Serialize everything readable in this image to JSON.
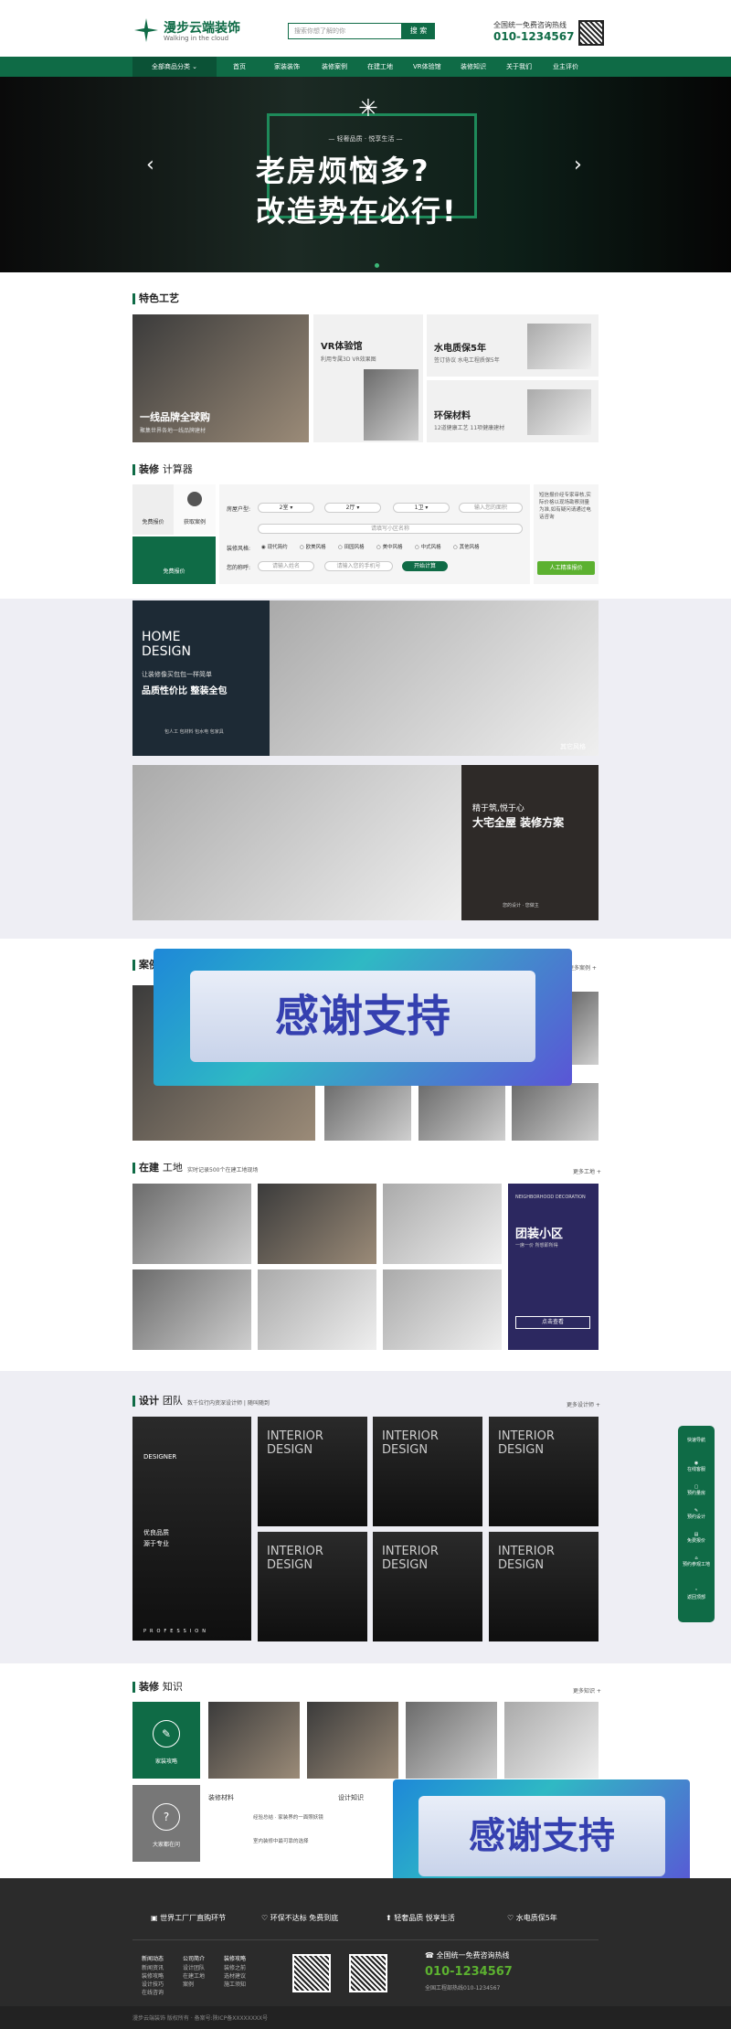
{
  "header": {
    "logo_name": "漫步云端装饰",
    "logo_sub": "Walking in the cloud",
    "search_placeholder": "搜索你想了解的你",
    "search_btn": "搜 索",
    "phone_title": "全国统一免费咨询热线",
    "phone": "010-1234567"
  },
  "nav": {
    "all": "全部商品分类",
    "items": [
      "首页",
      "家装装饰",
      "装修案例",
      "在建工地",
      "VR体验馆",
      "装修知识",
      "关于我们",
      "业主评价"
    ]
  },
  "banner": {
    "sub": "— 轻奢品质 · 悦享生活 —",
    "line1": "老房烦恼多?",
    "line2": "改造势在必行!"
  },
  "features": {
    "title": "特色工艺",
    "c1": "一线品牌全球购",
    "c1s": "聚集世界各地一线品牌建材",
    "c2": "VR体验馆",
    "c2s": "利用专属3D VR效果图",
    "c3": "水电质保5年",
    "c3s": "签订协议 水电工程质保5年",
    "c4": "环保材料",
    "c4s": "12道健康工艺 11项健康建材"
  },
  "calc": {
    "title": "装修",
    "title2": "计算器",
    "tab1": "免费报价",
    "tab2": "获取案例",
    "tab3": "免费报价",
    "house": "房屋户型:",
    "opt1": "2室",
    "opt2": "2厅",
    "opt3": "1卫",
    "area": "输入您的面积",
    "community": "请填写小区名称",
    "style_label": "装修风格:",
    "styles": [
      "现代简约",
      "欧美风格",
      "田园风格",
      "美中风格",
      "中式风格",
      "其他风格"
    ],
    "name_label": "您的称呼:",
    "name_ph": "请输入姓名",
    "phone_ph": "请输入您的手机号",
    "calc_btn": "开始计算",
    "right_text": "短信报价经专家审核,实际价格以现场勘察测量为准,如有疑问请通过电话咨询",
    "right_btn": "人工精准报价"
  },
  "promo": {
    "p1a": "HOME",
    "p1b": "DESIGN",
    "p1c": "让装修像买包包一样简单",
    "p1d": "品质性价比 整装全包",
    "p1e": "包人工 包材料 包水电 包家具",
    "p2a": "精于筑,悦于心",
    "p2b": "大宅全屋 装修方案",
    "p2c": "您的设计 · 您做主",
    "p3": "其它风格"
  },
  "cases": {
    "title": "案例",
    "more": "更多案例 +"
  },
  "overlay_text": "感谢支持",
  "sites": {
    "title": "在建",
    "title2": "工地",
    "sub": "实时记录500个在建工地现场",
    "more": "更多工地 +",
    "promo_en": "NEIGHBORHOOD DECORATION",
    "promo_title": "团装小区",
    "promo_sub": "一席一价 所想即所得",
    "promo_btn": "点击查看"
  },
  "team": {
    "title": "设计",
    "title2": "团队",
    "sub": "数千位行内资深设计师 | 随叫随到",
    "more": "更多设计师 +",
    "lead_en": "DESIGNER",
    "lead_cn": "优良品质",
    "lead_cn2": "源于专业",
    "bottom": "PROFESSION",
    "card": "INTERIOR DESIGN"
  },
  "knowledge": {
    "title": "装修",
    "title2": "知识",
    "more": "更多知识 +",
    "k1": "家装攻略",
    "k2": "大家都在问",
    "sub1": "装修材料",
    "sub2": "设计知识",
    "txt1": "经验总结 · 家装界的一面照妖镜",
    "txt2": "室内装修中最可靠的选择"
  },
  "footer_bar": [
    {
      "t": "世界工厂厂直购环节"
    },
    {
      "t": "环保不达标 免费到底"
    },
    {
      "t": "轻奢品质 悦享生活"
    },
    {
      "t": "水电质保5年"
    }
  ],
  "footer": {
    "cols": [
      {
        "h": "新闻动态",
        "items": [
          "新闻资讯",
          "装修攻略",
          "设计技巧",
          "在线咨询"
        ]
      },
      {
        "h": "公司简介",
        "items": [
          "设计团队",
          "在建工地",
          "案例"
        ]
      },
      {
        "h": "装修攻略",
        "items": [
          "装修之前",
          "选材建议",
          "施工须知"
        ]
      }
    ],
    "phone_title": "全国统一免费咨询热线",
    "phone": "010-1234567",
    "phone2": "全国工程部热线010-1234567",
    "copyright": "漫步云端装饰 版权所有 · 备案号:陕ICP备XXXXXXXX号"
  },
  "side": {
    "items": [
      "快速导航",
      "在线客服",
      "预约量房",
      "预约设计",
      "免费报价",
      "预约参观工地",
      "返回顶部"
    ]
  }
}
